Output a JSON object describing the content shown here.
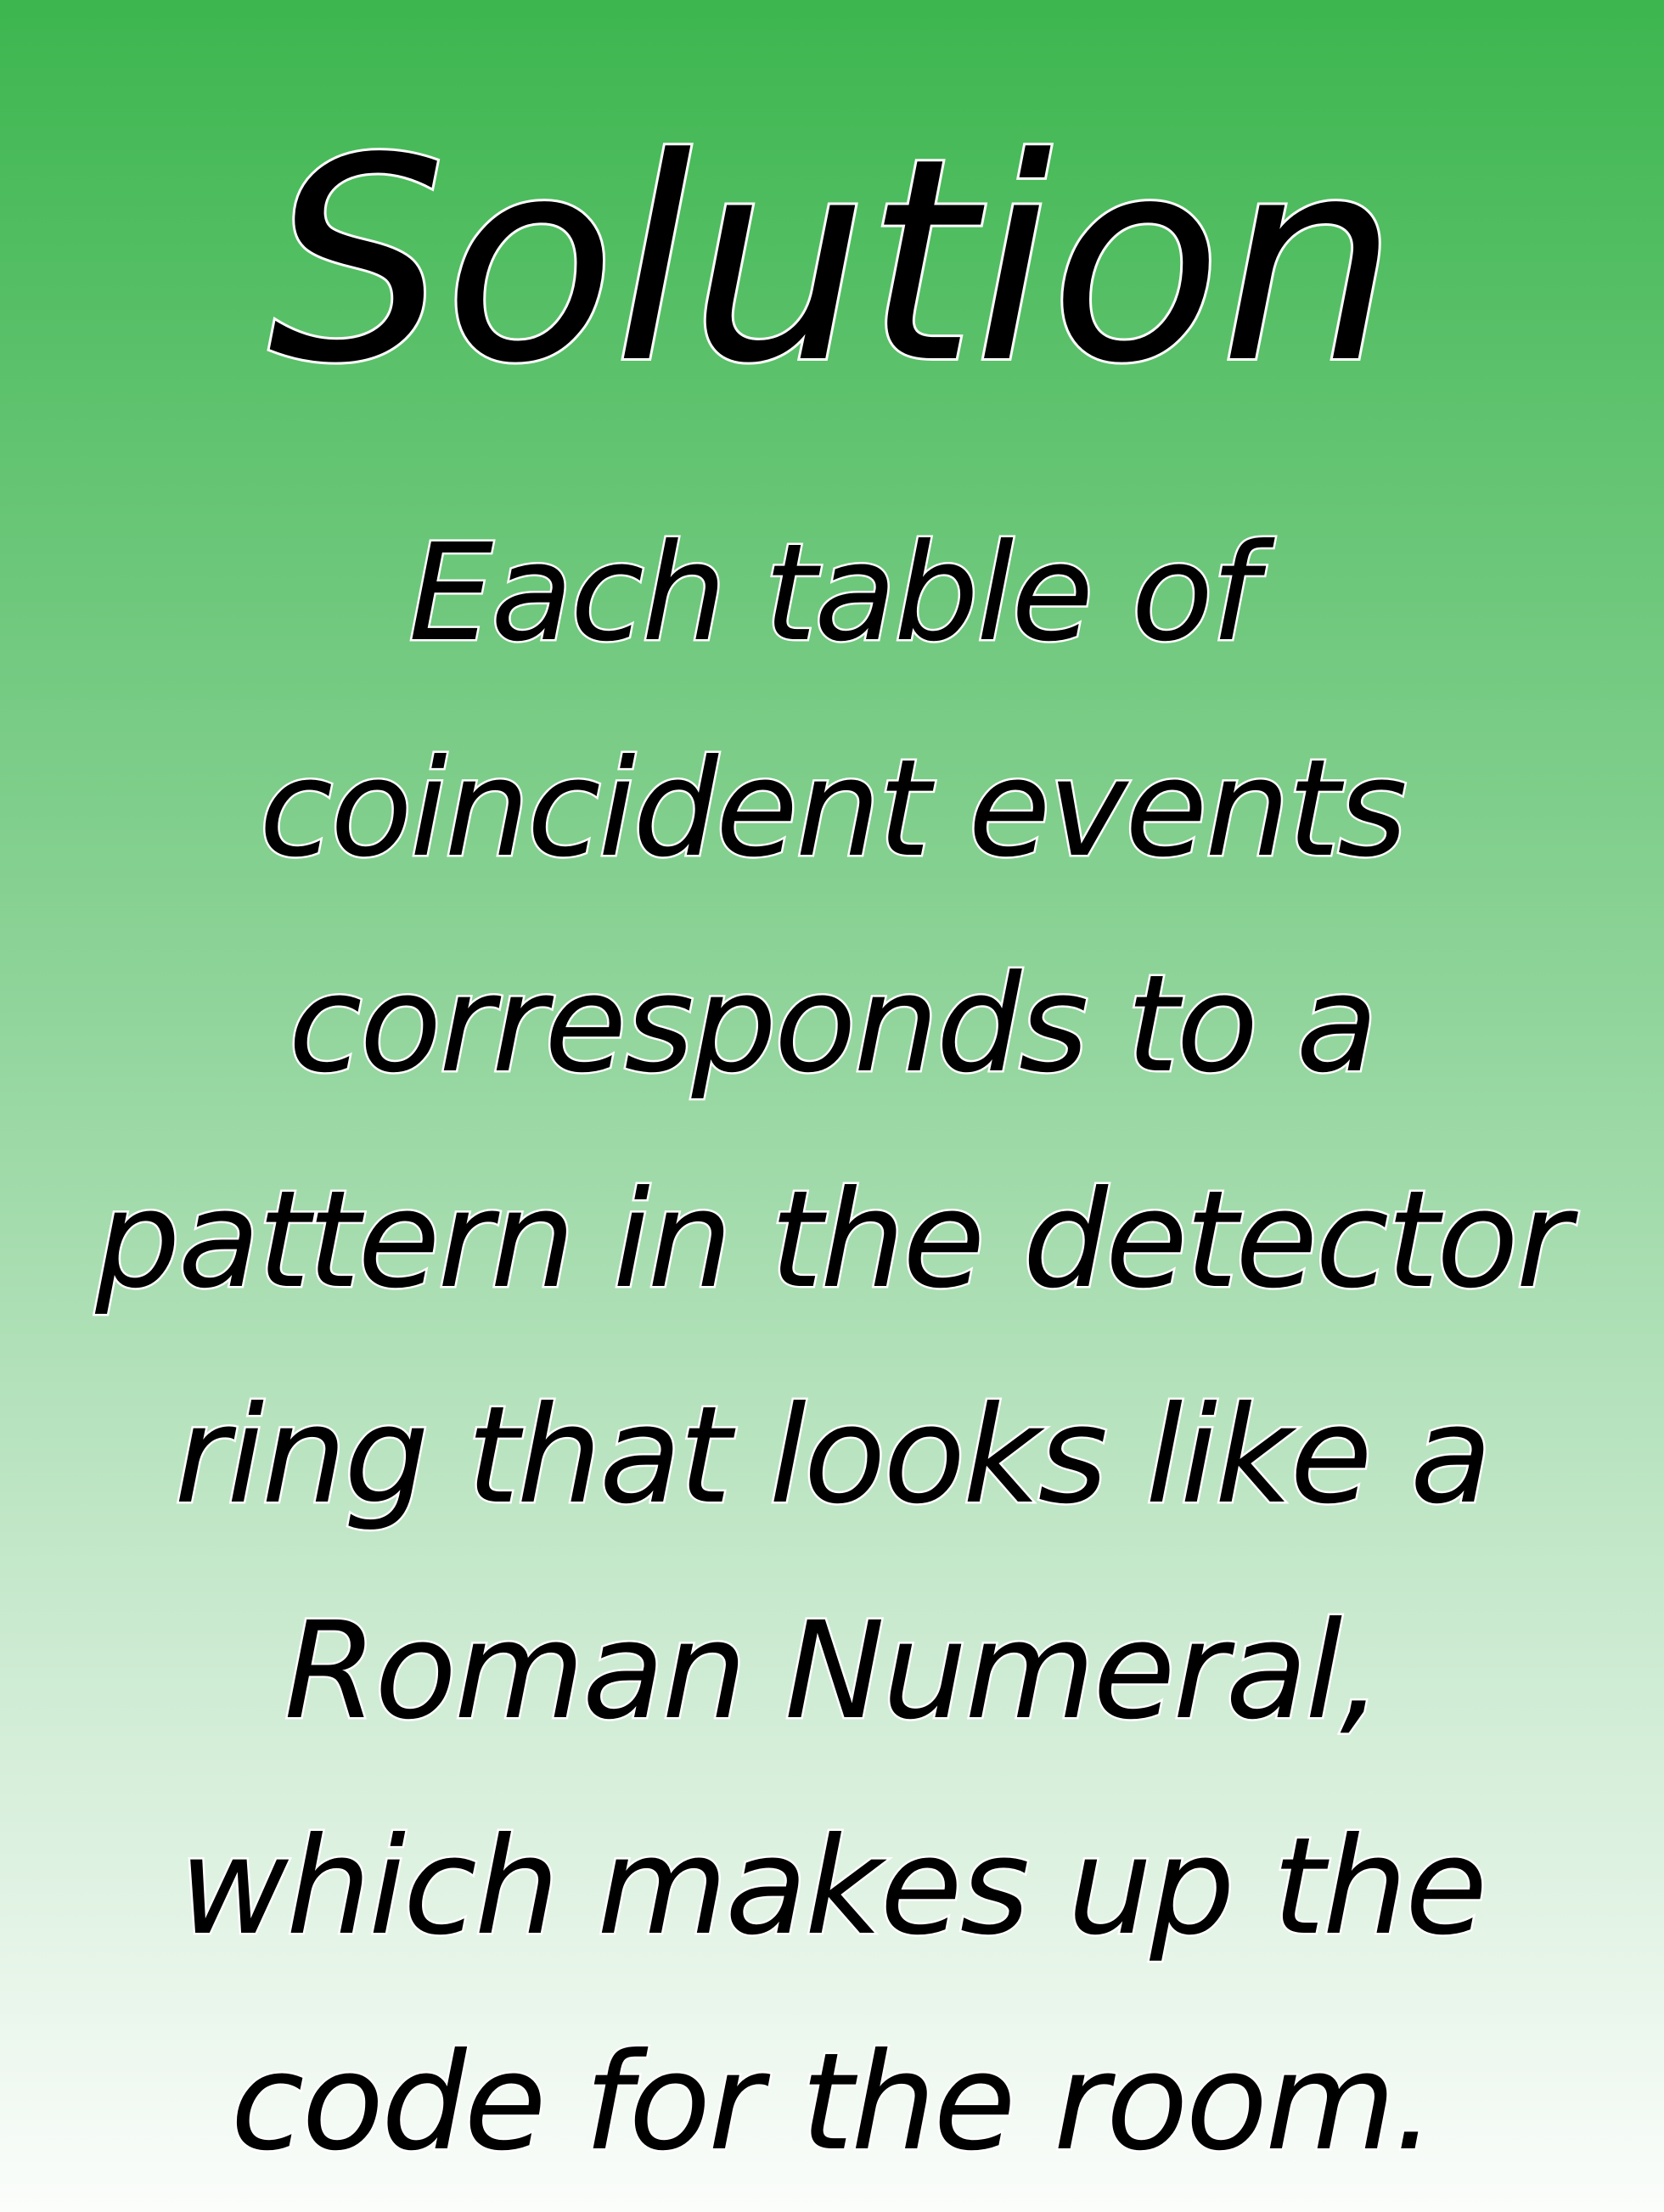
{
  "title": "Solution",
  "lines": [
    "Each table of",
    "coincident events",
    "corresponds to a",
    "pattern in the detector",
    "ring that looks like a",
    "Roman Numeral,",
    "which makes up the",
    "code for the room."
  ],
  "colors": {
    "gradient_top": "#3db64f",
    "gradient_bottom": "#fbfdfb",
    "text": "#000000",
    "text_outline": "#ffffff"
  }
}
